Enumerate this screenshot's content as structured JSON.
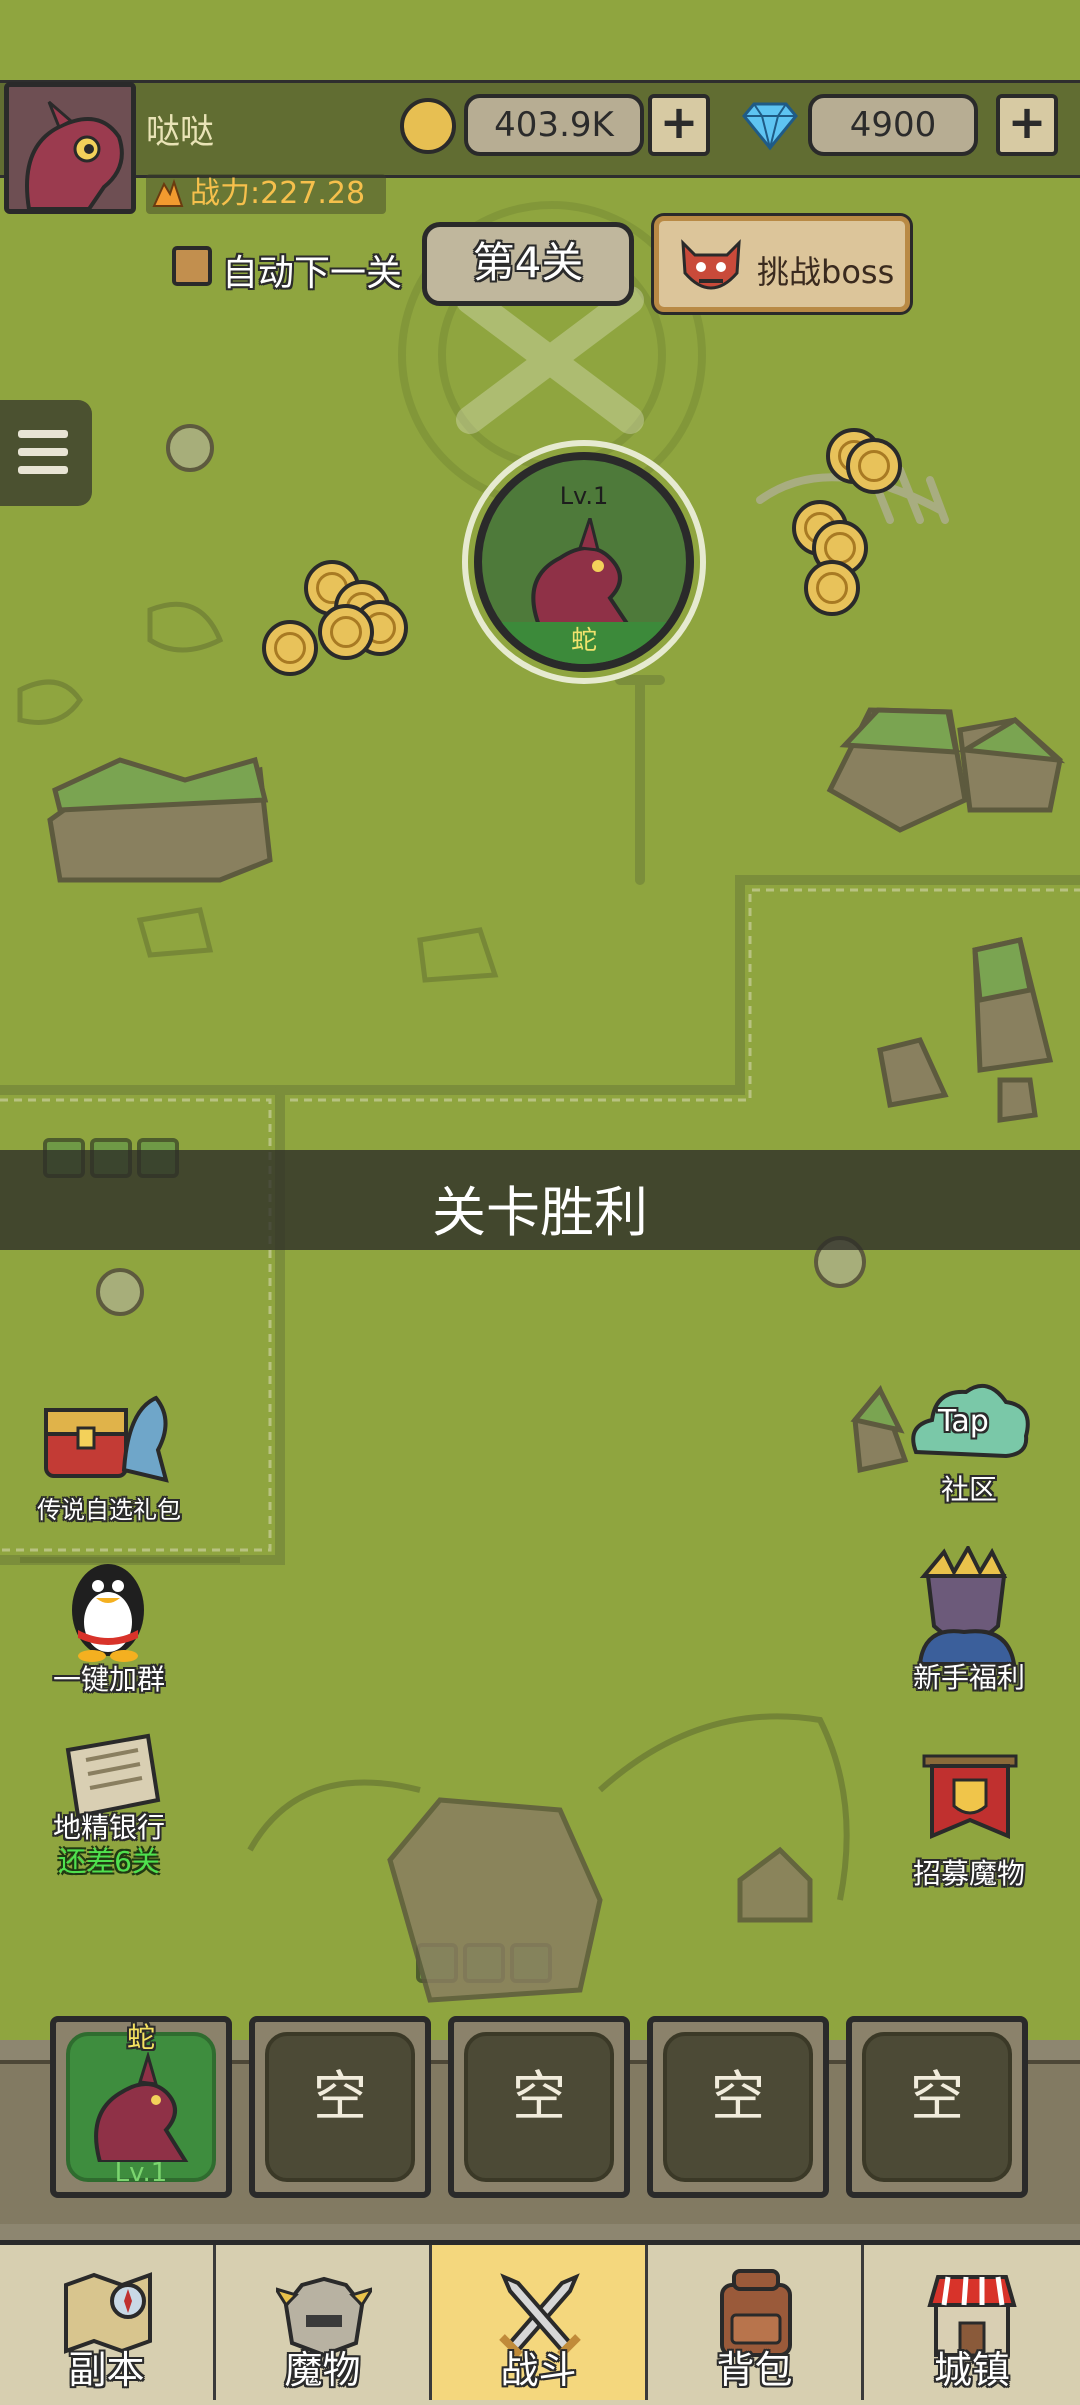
{
  "player": {
    "name": "哒哒",
    "power": "战力:227.28",
    "gold": "403.9K",
    "diamonds": "4900",
    "plus": "+"
  },
  "stage": {
    "auto_next_label": "自动下一关",
    "auto_next_checked": false,
    "current_stage": "第4关",
    "boss_button_label": "挑战boss"
  },
  "monster": {
    "level": "Lv.1",
    "name": "蛇"
  },
  "banner": {
    "text": "关卡胜利"
  },
  "left_features": [
    {
      "label": "传说自选礼包",
      "icon": "treasure-chest-icon"
    },
    {
      "label": "一键加群",
      "icon": "penguin-icon"
    },
    {
      "label": "地精银行",
      "sub": "还差6关",
      "icon": "newspaper-icon"
    }
  ],
  "right_features": [
    {
      "label": "社区",
      "badge": "Tap",
      "icon": "cloud-icon"
    },
    {
      "label": "新手福利",
      "icon": "knight-icon"
    },
    {
      "label": "招募魔物",
      "icon": "banner-shield-icon"
    }
  ],
  "team_slots": [
    {
      "name": "蛇",
      "level": "Lv.1",
      "filled": true
    },
    {
      "label": "空",
      "filled": false
    },
    {
      "label": "空",
      "filled": false
    },
    {
      "label": "空",
      "filled": false
    },
    {
      "label": "空",
      "filled": false
    }
  ],
  "nav_tabs": [
    {
      "label": "副本",
      "icon": "map-compass-icon",
      "active": false
    },
    {
      "label": "魔物",
      "icon": "helmet-icon",
      "active": false
    },
    {
      "label": "战斗",
      "icon": "crossed-swords-icon",
      "active": true
    },
    {
      "label": "背包",
      "icon": "backpack-icon",
      "active": false
    },
    {
      "label": "城镇",
      "icon": "shop-icon",
      "active": false
    }
  ],
  "colors": {
    "map_green": "#8fa53f",
    "gold_text": "#f6c04c",
    "active_tab": "#f4d77d",
    "slot_active": "#3e8d3e"
  }
}
